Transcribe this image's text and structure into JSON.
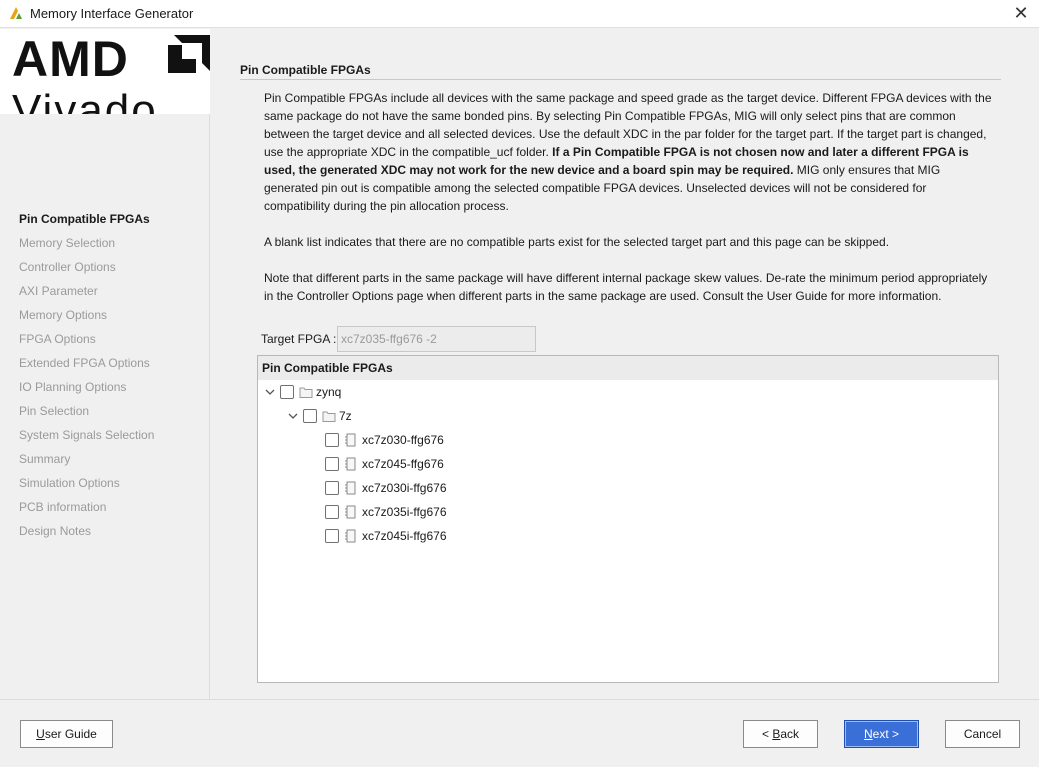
{
  "window": {
    "title": "Memory Interface Generator",
    "close_glyph": "✕"
  },
  "logo": {
    "brand": "AMD",
    "product": "Vivado"
  },
  "nav": {
    "items": [
      {
        "label": "Pin Compatible FPGAs",
        "active": true
      },
      {
        "label": "Memory Selection"
      },
      {
        "label": "Controller Options"
      },
      {
        "label": "AXI Parameter"
      },
      {
        "label": "Memory Options"
      },
      {
        "label": "FPGA Options"
      },
      {
        "label": "Extended FPGA Options"
      },
      {
        "label": "IO Planning Options"
      },
      {
        "label": "Pin Selection"
      },
      {
        "label": "System Signals Selection"
      },
      {
        "label": "Summary"
      },
      {
        "label": "Simulation Options"
      },
      {
        "label": "PCB information"
      },
      {
        "label": "Design Notes"
      }
    ]
  },
  "main": {
    "section_title": "Pin Compatible FPGAs",
    "para1_a": "Pin Compatible FPGAs include all devices with the same package and speed grade as the target device. Different FPGA devices with the same package do not have the same bonded pins. By selecting Pin Compatible FPGAs, MIG will only select pins that are common between the target device and all selected devices. Use the default XDC in the par folder for the target part. If the target part is changed, use the appropriate XDC in the compatible_ucf folder. ",
    "para1_bold": "If a Pin Compatible FPGA is not chosen now and later a different FPGA is used, the generated XDC may not work for the new device and a board spin may be required.",
    "para1_b": " MIG only ensures that MIG generated pin out is compatible among the selected compatible FPGA devices. Unselected devices will not be considered for compatibility during the pin allocation process.",
    "para2": "A blank list indicates that there are no compatible parts exist for the selected target part and this page can be skipped.",
    "para3": "Note that different parts in the same package will have different internal package skew values. De-rate the minimum period appropriately in the Controller Options page when different parts in the same package are used. Consult the User Guide for more information.",
    "target_label": "Target FPGA :",
    "target_value": "xc7z035-ffg676 -2",
    "tree": {
      "header": "Pin Compatible FPGAs",
      "family": "zynq",
      "subfamily": "7z",
      "parts": [
        {
          "label": "xc7z030-ffg676",
          "checked": false
        },
        {
          "label": "xc7z045-ffg676",
          "checked": false
        },
        {
          "label": "xc7z030i-ffg676",
          "checked": false
        },
        {
          "label": "xc7z035i-ffg676",
          "checked": false
        },
        {
          "label": "xc7z045i-ffg676",
          "checked": false
        }
      ]
    }
  },
  "footer": {
    "user_guide_ul": "U",
    "user_guide_rest": "ser Guide",
    "back_pre": "< ",
    "back_ul": "B",
    "back_rest": "ack",
    "next_ul": "N",
    "next_rest": "ext >",
    "cancel": "Cancel"
  },
  "colors": {
    "primary_button": "#3b6fd8",
    "disabled_text": "#9a9a9a",
    "panel_bg": "#f0f0f0"
  },
  "icons": {
    "app": "vivado-logo-icon",
    "close": "close-icon",
    "expand": "chevron-down-icon",
    "folder": "folder-icon",
    "part": "chip-icon"
  }
}
